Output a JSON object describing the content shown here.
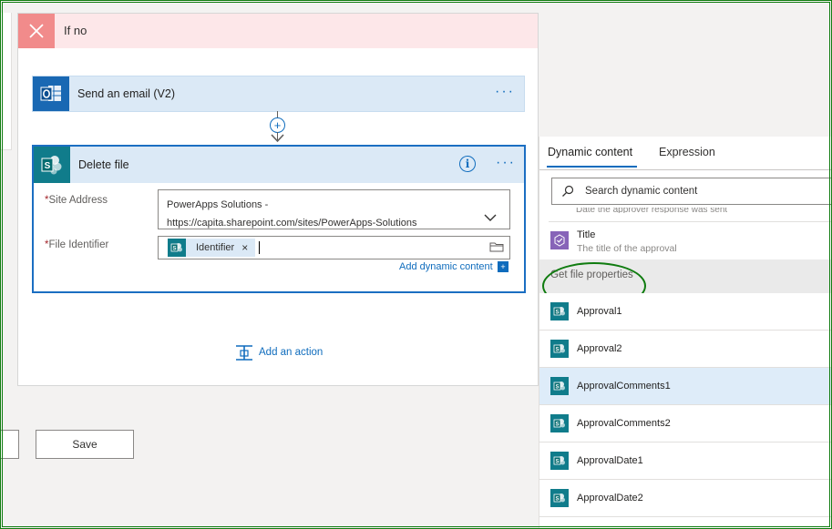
{
  "condition": {
    "title": "If no",
    "close_icon": "close-icon"
  },
  "email_action": {
    "title": "Send an email (V2)",
    "icon": "outlook-icon",
    "more": "···"
  },
  "delete_action": {
    "title": "Delete file",
    "icon": "sharepoint-icon",
    "info": "i",
    "more": "···",
    "fields": {
      "site_label": "Site Address",
      "site_value": "PowerApps Solutions - https://capita.sharepoint.com/sites/PowerApps-Solutions",
      "file_label": "File Identifier",
      "file_token": "Identifier",
      "token_remove": "×"
    },
    "add_dynamic": "Add dynamic content",
    "add_dynamic_icon": "+"
  },
  "add_action": {
    "label": "Add an action"
  },
  "footer": {
    "save_label": "Save"
  },
  "dynamic_panel": {
    "tabs": [
      "Dynamic content",
      "Expression"
    ],
    "search_placeholder": "Search dynamic content",
    "cut_text": "Date the approver response was sent",
    "title_item": {
      "name": "Title",
      "desc": "The title of the approval"
    },
    "group_label": "Get file properties",
    "items": [
      "Approval1",
      "Approval2",
      "ApprovalComments1",
      "ApprovalComments2",
      "ApprovalDate1",
      "ApprovalDate2"
    ],
    "selected_item": "ApprovalComments1"
  },
  "colors": {
    "accent": "#0f6cbd",
    "outlook": "#1968b3",
    "sharepoint": "#107c8b",
    "approvals": "#8764b8",
    "condition_no": "#fde7e9",
    "highlight_ring": "#107c10"
  }
}
